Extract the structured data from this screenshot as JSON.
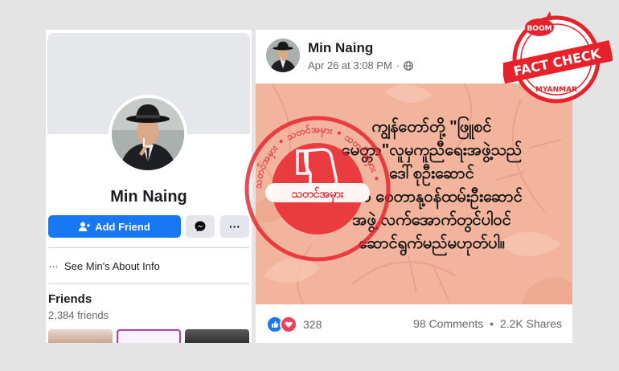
{
  "profile": {
    "name": "Min Naing",
    "add_friend_label": "Add Friend",
    "more_label": "···",
    "about_label": "See Min's About Info",
    "friends_title": "Friends",
    "friends_count": "2,384 friends"
  },
  "post": {
    "author": "Min Naing",
    "timestamp": "Apr 26 at 3:08 PM",
    "separator": "·",
    "audience_icon": "globe-icon",
    "image_text_lines": [
      "ကျွန်တော်တို့ \"ဖြူစင်",
      "မေတ္တာ\"လူမှကူညီရေးအဖွဲ့သည်",
      "ဒေါ်စုဦးဆောင်",
      "သော စေတာနု့ဝန်ထမ်းဦးဆောင်",
      "အဖွဲ့ လက်အောက်တွင်ပါဝင်",
      "ဆောင်ရွက်မည်မဟုတ်ပါ။"
    ],
    "reaction_count": "328",
    "comments_label": "98 Comments",
    "shares_label": "2.2K Shares",
    "stats_separator": "•"
  },
  "stamp": {
    "center_text": "သတင်အမှား",
    "ring_text": "သတင်အမှား • သတင်အမှား • သတင်အမှား •",
    "color": "#e8212b"
  },
  "badge": {
    "top_text": "BOOM",
    "main_text": "FACT CHECK",
    "bottom_text": "MYANMAR",
    "color": "#e8212b"
  },
  "colors": {
    "accent": "#1877f2",
    "love": "#f33e58",
    "image_bg": "#f2b39c"
  }
}
